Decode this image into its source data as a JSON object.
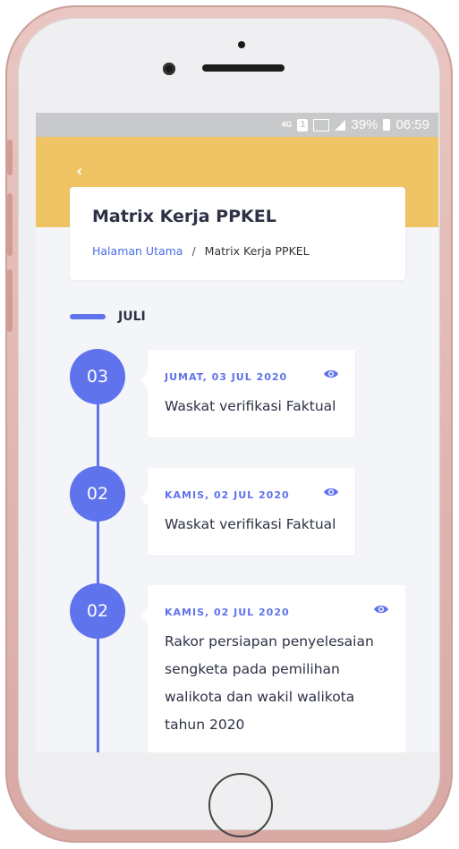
{
  "statusbar": {
    "network": "4G",
    "sim": "1",
    "battery_percent": "39%",
    "time": "06:59"
  },
  "header": {
    "title": "Matrix Kerja PPKEL",
    "breadcrumb": {
      "home": "Halaman Utama",
      "separator": "/",
      "current": "Matrix Kerja PPKEL"
    }
  },
  "timeline": {
    "month": "JULI",
    "events": [
      {
        "day": "03",
        "date": "JUMAT, 03 JUL 2020",
        "text": "Waskat verifikasi Faktual"
      },
      {
        "day": "02",
        "date": "KAMIS, 02 JUL 2020",
        "text": "Waskat verifikasi Faktual"
      },
      {
        "day": "02",
        "date": "KAMIS, 02 JUL 2020",
        "text_lines": [
          "Rakor persiapan penyelesaian",
          "sengketa pada pemilihan",
          "walikota dan wakil walikota",
          "tahun 2020"
        ]
      }
    ]
  },
  "colors": {
    "header_band": "#efc464",
    "accent": "#5f73ec",
    "title": "#2d3145",
    "link": "#4a6fe3",
    "background": "#f4f5f9"
  }
}
